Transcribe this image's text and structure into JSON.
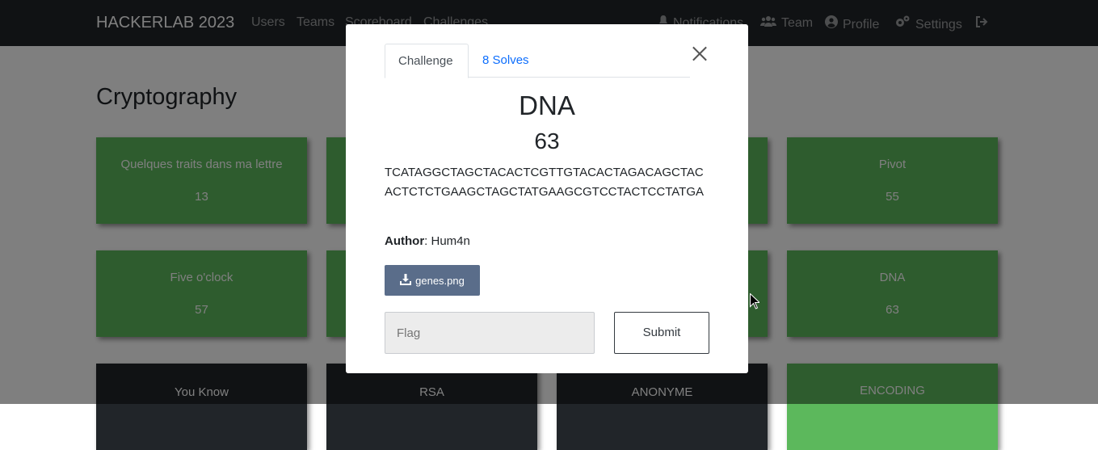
{
  "navbar": {
    "brand": "HACKERLAB 2023",
    "links": [
      "Users",
      "Teams",
      "Scoreboard",
      "Challenges"
    ],
    "right_links": [
      {
        "label": "Notifications",
        "icon": "bell-icon"
      },
      {
        "label": "Team",
        "icon": "users-icon"
      },
      {
        "label": "Profile",
        "icon": "user-circle-icon"
      },
      {
        "label": "Settings",
        "icon": "gears-icon"
      }
    ],
    "logout_icon": "logout-icon"
  },
  "page": {
    "category_title": "Cryptography",
    "challenges": [
      {
        "name": "Quelques traits dans ma lettre",
        "value": "13",
        "solved": true
      },
      {
        "name": "Pivot",
        "value": "55",
        "solved": true
      },
      {
        "name": "Five o'clock",
        "value": "57",
        "solved": true
      },
      {
        "name": "DNA",
        "value": "63",
        "solved": true
      },
      {
        "name": "You Know",
        "value": "",
        "solved": false
      },
      {
        "name": "RSA",
        "value": "",
        "solved": false
      },
      {
        "name": "ANONYME",
        "value": "",
        "solved": false
      },
      {
        "name": "ENCODING",
        "value": "",
        "solved": true
      }
    ]
  },
  "modal": {
    "tab_challenge": "Challenge",
    "tab_solves": "8 Solves",
    "name": "DNA",
    "value": "63",
    "description": "TCATAGGCTAGCTACACTCGTTGTACACTAGACAGCTACACTCTCTGAAGCTAGCTATGAAGCGTCCTACTCCTATGA",
    "author_label": "Author",
    "author": ": Hum4n",
    "file_name": "genes.png",
    "flag_placeholder": "Flag",
    "submit_label": "Submit"
  },
  "colors": {
    "navbar": "#212529",
    "solved": "#5cb85c",
    "unsolved": "#212529",
    "file_button": "#5a6d8a",
    "link": "#0d6efd"
  }
}
